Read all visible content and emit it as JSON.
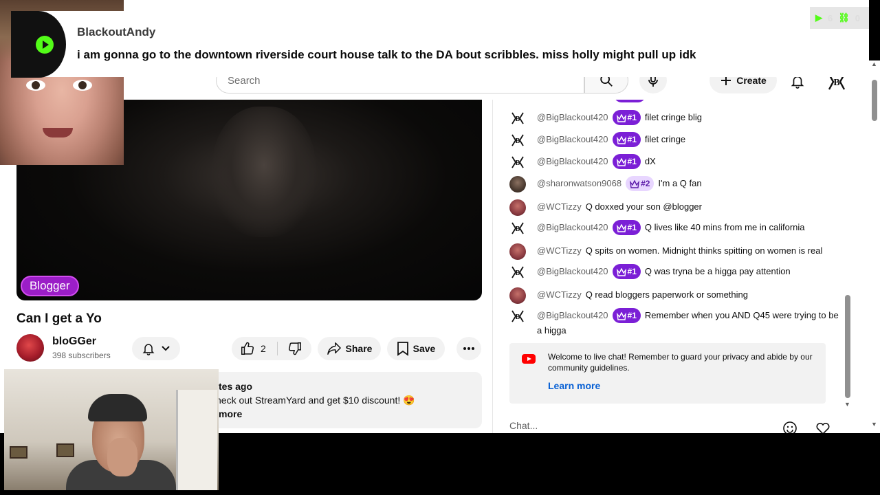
{
  "header": {
    "search_placeholder": "Search",
    "create_label": "Create"
  },
  "video": {
    "badge": "Blogger",
    "title": "Can I get a Yo",
    "channel_name": "bloGGer",
    "subscribers": "398 subscribers",
    "likes": "2",
    "share_label": "Share",
    "save_label": "Save"
  },
  "description": {
    "line1": "tes ago",
    "line2": "heck out StreamYard and get $10 discount! 😍",
    "line3": "more"
  },
  "chat": {
    "messages": [
      {
        "author": "@BigBlackout420",
        "badge": "#1",
        "text": "filet cringe blig"
      },
      {
        "author": "@BigBlackout420",
        "badge": "#1",
        "text": "filet cringe"
      },
      {
        "author": "@BigBlackout420",
        "badge": "#1",
        "text": "dX"
      },
      {
        "author": "@sharonwatson9068",
        "badge": "#2",
        "text": "I'm a Q fan"
      },
      {
        "author": "@WCTizzy",
        "badge": "",
        "text": "Q doxxed your son @blogger"
      },
      {
        "author": "@BigBlackout420",
        "badge": "#1",
        "text": "Q lives like 40 mins from me in california"
      },
      {
        "author": "@WCTizzy",
        "badge": "",
        "text": "Q spits on women. Midnight thinks spitting on women is real"
      },
      {
        "author": "@BigBlackout420",
        "badge": "#1",
        "text": "Q was tryna be a higga pay attention"
      },
      {
        "author": "@WCTizzy",
        "badge": "",
        "text": "Q read bloggers paperwork or something"
      },
      {
        "author": "@BigBlackout420",
        "badge": "#1",
        "text": "Remember when you AND Q45 were trying to be a higga"
      }
    ],
    "welcome_text": "Welcome to live chat! Remember to guard your privacy and abide by our community guidelines.",
    "learn_more": "Learn more",
    "input_placeholder": "Chat..."
  },
  "overlay": {
    "username": "BlackoutAndy",
    "message": "i am gonna go to the downtown riverside court house talk to the DA bout scribbles. miss holly might pull up idk",
    "stat_views": "6",
    "stat_links": "0"
  },
  "colors": {
    "badge_purple": "#7b1fd6",
    "blogger_badge": "#9b1ec7",
    "kick_green": "#53fc18",
    "link_blue": "#065fd4"
  },
  "icons": [
    "search-icon",
    "mic-icon",
    "plus-icon",
    "bell-icon",
    "thumbs-up-icon",
    "thumbs-down-icon",
    "share-icon",
    "bookmark-icon",
    "more-icon",
    "crown-icon",
    "emoji-icon",
    "heart-icon",
    "youtube-icon",
    "kick-logo-icon",
    "link-icon"
  ]
}
